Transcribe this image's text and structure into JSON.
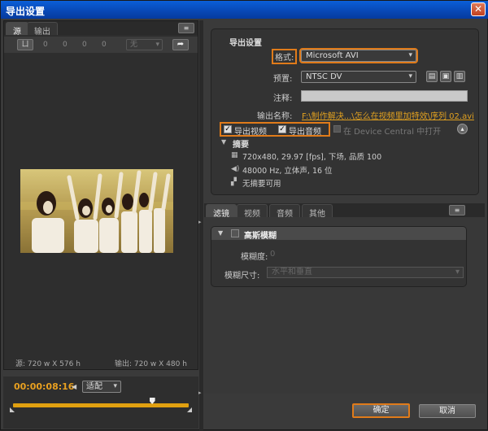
{
  "window": {
    "title": "导出设置",
    "close": "✕"
  },
  "source_panel": {
    "tabs": [
      "源",
      "输出"
    ],
    "menu_icon": "≡",
    "crop_icon": "crop-icon",
    "crop_glyph": "ㄩ",
    "crop_values": [
      "0",
      "0",
      "0",
      "0"
    ],
    "aspect_select": "无",
    "rotate_glyph": "➦",
    "source_info": "源: 720 w X 576 h",
    "output_info": "输出: 720 w X 480 h"
  },
  "timeline": {
    "timecode": "00:00:08:16",
    "fit_select": "适配",
    "progress": 0.79
  },
  "export_settings": {
    "section_title": "导出设置",
    "format_label": "格式:",
    "format_value": "Microsoft AVI",
    "preset_label": "预置:",
    "preset_value": "NTSC DV",
    "comment_label": "注释:",
    "output_name_label": "输出名称:",
    "output_name_value": "F:\\制作解决...\\怎么在视频里加特效\\序列 02.avi",
    "export_video": "导出视频",
    "export_audio": "导出音频",
    "device_central": "在 Device Central 中打开",
    "summary_title": "摘要",
    "summary": [
      "720x480, 29.97 [fps], 下场, 品质 100",
      "48000 Hz, 立体声, 16 位",
      "无摘要可用"
    ]
  },
  "bottom_tabs": [
    "滤镜",
    "视频",
    "音频",
    "其他"
  ],
  "filter": {
    "title": "高斯模糊",
    "blurriness_label": "模糊度:",
    "blurriness_value": "0",
    "dimension_label": "模糊尺寸:",
    "dimension_value": "水平和垂直"
  },
  "buttons": {
    "ok": "确定",
    "cancel": "取消"
  },
  "colors": {
    "accent": "#e07b1a",
    "timecode": "#e8a020",
    "title_bar": "#0847b4"
  }
}
